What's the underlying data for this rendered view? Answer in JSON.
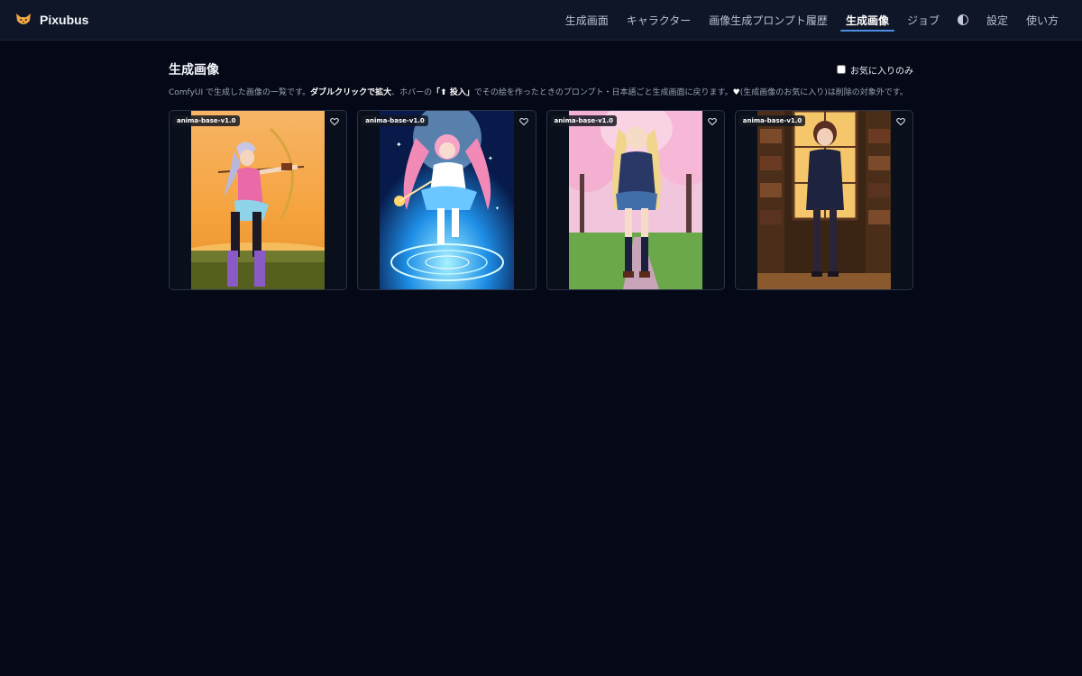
{
  "header": {
    "app_name": "Pixubus",
    "logo_icon": "fox-icon",
    "nav": [
      {
        "label": "生成画面",
        "active": false
      },
      {
        "label": "キャラクター",
        "active": false
      },
      {
        "label": "画像生成プロンプト履歴",
        "active": false
      },
      {
        "label": "生成画像",
        "active": true
      },
      {
        "label": "ジョブ",
        "active": false
      },
      {
        "label": "設定",
        "active": false
      },
      {
        "label": "使い方",
        "active": false
      }
    ],
    "theme_icon": "half-circle-icon",
    "accent": "#4a90e2"
  },
  "main": {
    "title": "生成画像",
    "favorites_filter_label": "お気に入りのみ",
    "description": {
      "p1": "ComfyUI で生成した画像の一覧です。",
      "b1": "ダブルクリックで拡大",
      "p2": "、ホバーの",
      "b2": "「⬆ 投入」",
      "p3": "でその絵を作ったときのプロンプト・日本語ごと生成画面に戻ります。",
      "heart": "♥",
      "p4": "(生成画像のお気に入り)は削除の対象外です。"
    },
    "images": [
      {
        "badge": "anima-base-v1.0",
        "subject": "archer"
      },
      {
        "badge": "anima-base-v1.0",
        "subject": "magical-girl"
      },
      {
        "badge": "anima-base-v1.0",
        "subject": "cherry-blossom-schoolgirl"
      },
      {
        "badge": "anima-base-v1.0",
        "subject": "library-girl"
      }
    ]
  }
}
